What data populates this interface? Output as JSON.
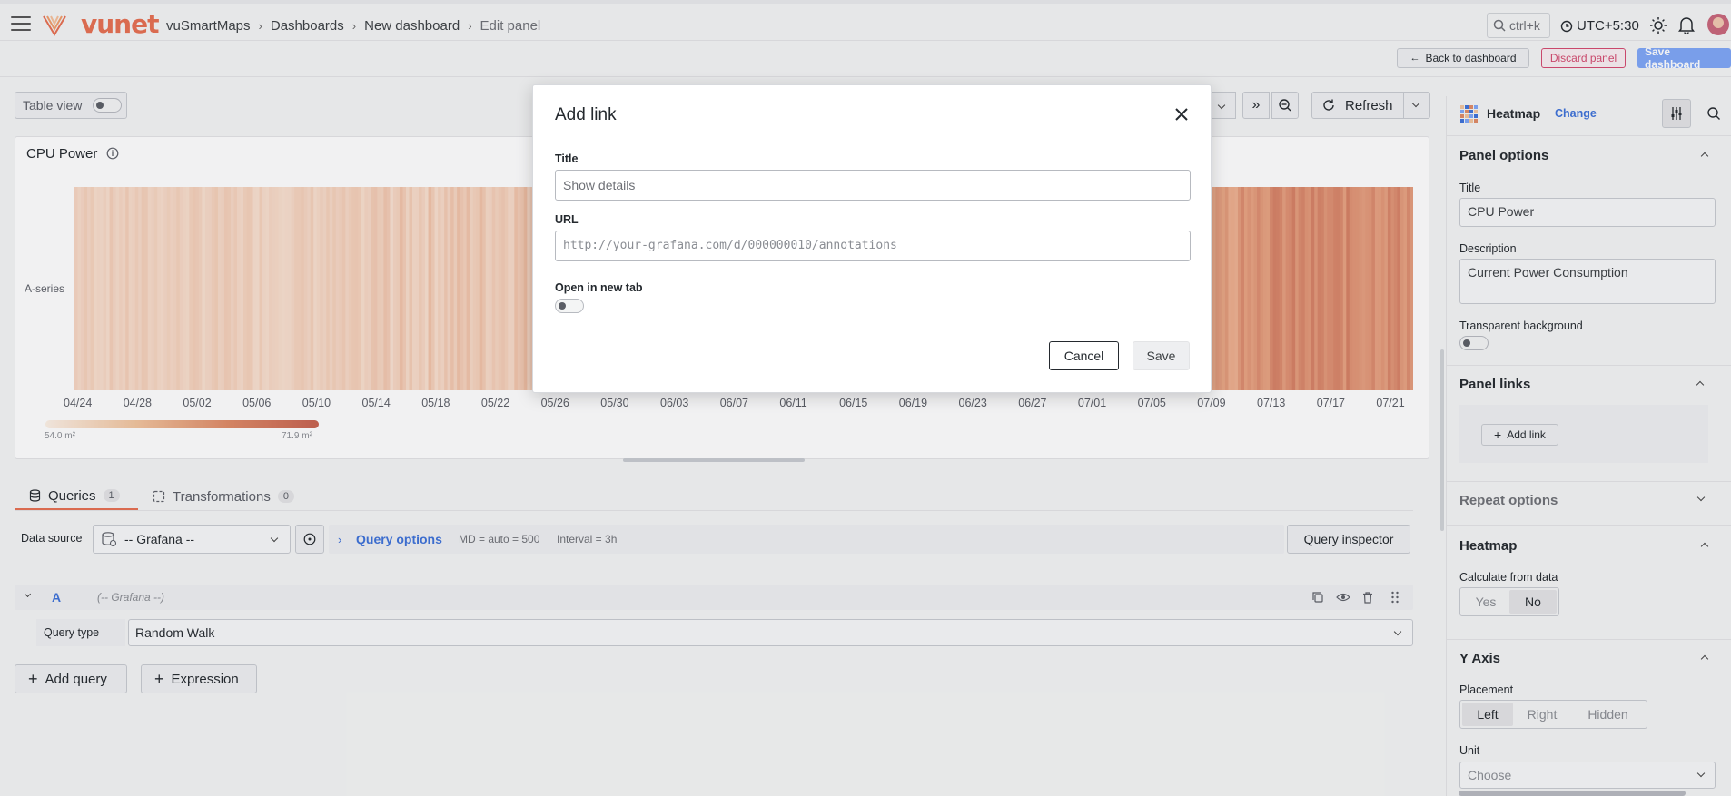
{
  "topbar": {
    "logo": "vunet",
    "breadcrumbs": [
      "vuSmartMaps",
      "Dashboards",
      "New dashboard",
      "Edit panel"
    ],
    "search_hint": "ctrl+k",
    "timezone": "UTC+5:30"
  },
  "actions": {
    "back": "Back to dashboard",
    "discard": "Discard panel",
    "save": "Save dashboard"
  },
  "toolbar": {
    "table_view": "Table view",
    "refresh": "Refresh"
  },
  "panel": {
    "title": "CPU Power",
    "series_label": "A-series",
    "legend_min": "54.0 m²",
    "legend_max": "71.9 m²",
    "x_ticks": [
      "04/24",
      "04/28",
      "05/02",
      "05/06",
      "05/10",
      "05/14",
      "05/18",
      "05/22",
      "05/26",
      "05/30",
      "06/03",
      "06/07",
      "06/11",
      "06/15",
      "06/19",
      "06/23",
      "06/27",
      "07/01",
      "07/05",
      "07/09",
      "07/13",
      "07/17",
      "07/21"
    ]
  },
  "query_tabs": {
    "queries_label": "Queries",
    "queries_count": "1",
    "transformations_label": "Transformations",
    "transformations_count": "0"
  },
  "query_row": {
    "data_source_label": "Data source",
    "data_source_value": "-- Grafana --",
    "options_label": "Query options",
    "md": "MD = auto = 500",
    "interval": "Interval = 3h",
    "inspector": "Query inspector"
  },
  "query_a": {
    "letter": "A",
    "source": "(-- Grafana --)",
    "type_label": "Query type",
    "type_value": "Random Walk"
  },
  "query_buttons": {
    "add_query": "Add query",
    "expression": "Expression"
  },
  "sidebar": {
    "viz_name": "Heatmap",
    "change": "Change",
    "panel_options": "Panel options",
    "title_label": "Title",
    "title_value": "CPU Power",
    "description_label": "Description",
    "description_value": "Current Power Consumption",
    "transparent_label": "Transparent background",
    "panel_links": "Panel links",
    "add_link": "Add link",
    "repeat_options": "Repeat options",
    "heatmap_section": "Heatmap",
    "calculate_label": "Calculate from data",
    "calc_yes": "Yes",
    "calc_no": "No",
    "y_axis": "Y Axis",
    "placement_label": "Placement",
    "placement_left": "Left",
    "placement_right": "Right",
    "placement_hidden": "Hidden",
    "unit_label": "Unit",
    "unit_placeholder": "Choose"
  },
  "modal": {
    "title": "Add link",
    "title_label": "Title",
    "title_placeholder": "Show details",
    "url_label": "URL",
    "url_placeholder": "http://your-grafana.com/d/000000010/annotations",
    "new_tab_label": "Open in new tab",
    "cancel": "Cancel",
    "save": "Save"
  },
  "colors": {
    "brand": "#e76f51",
    "primary": "#6e9fff",
    "danger": "#d44a6f",
    "link": "#3d71d9"
  }
}
